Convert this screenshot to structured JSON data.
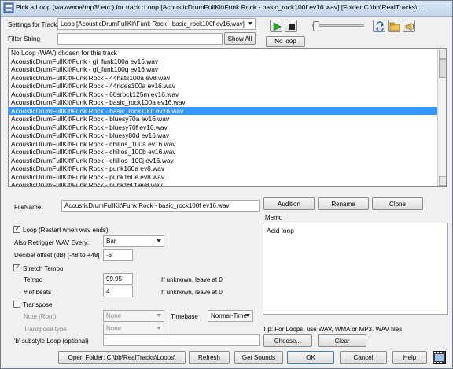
{
  "window": {
    "title": "Pick a Loop (wav/wma/mp3/ etc.) for track :Loop   [AcousticDrumFullKit\\Funk Rock - basic_rock100f ev16.wav]   [Folder:C:\\bb\\RealTracks\\..."
  },
  "settings": {
    "label": "Settings for Track",
    "track_value": "Loop   [AcousticDrumFullKit\\Funk Rock - basic_rock100f ev16.wav]",
    "filter_label": "Filter String",
    "filter_value": "",
    "show_all_label": "Show All",
    "no_loop_label": "No loop"
  },
  "transport": {
    "play_icon": "play-icon",
    "stop_icon": "stop-icon",
    "volume_level": 0.05
  },
  "file_list": {
    "items": [
      "No Loop (WAV) chosen for this track",
      "AcousticDrumFullKit\\Funk - gl_funk100a ev16.wav",
      "AcousticDrumFullKit\\Funk - gl_funk100q ev16.wav",
      "AcousticDrumFullKit\\Funk Rock - 44hats100a ev8.wav",
      "AcousticDrumFullKit\\Funk Rock - 44rides100a ev16.wav",
      "AcousticDrumFullKit\\Funk Rock - 60srock125m ev16.wav",
      "AcousticDrumFullKit\\Funk Rock - basic_rock100a ev16.wav",
      "AcousticDrumFullKit\\Funk Rock - basic_rock100f ev16.wav",
      "AcousticDrumFullKit\\Funk Rock - bluesy70a ev16.wav",
      "AcousticDrumFullKit\\Funk Rock - bluesy70f ev16.wav",
      "AcousticDrumFullKit\\Funk Rock - bluesy80d ev16.wav",
      "AcousticDrumFullKit\\Funk Rock - chillos_100a ev16.wav",
      "AcousticDrumFullKit\\Funk Rock - chillos_100b ev16.wav",
      "AcousticDrumFullKit\\Funk Rock - chillos_100j ev16.wav",
      "AcousticDrumFullKit\\Funk Rock - punk160a ev8.wav",
      "AcousticDrumFullKit\\Funk Rock - punk160e ev8.wav",
      "AcousticDrumFullKit\\Funk Rock - punk160f ev8.wav"
    ],
    "selected_index": 7
  },
  "details": {
    "filename_label": "FileName:",
    "filename_value": "AcousticDrumFullKit\\Funk Rock - basic_rock100f ev16.wav",
    "audition_label": "Audition",
    "rename_label": "Rename",
    "clone_label": "Clone",
    "memo_label": "Memo :",
    "memo_text": "Acid loop",
    "loop_label": "Loop (Restart when wav ends)",
    "loop_checked": true,
    "retrigger_label": "Also Retrigger WAV Every:",
    "retrigger_value": "Bar",
    "decibel_label": "Decibel offset (dB) [-48 to +48]",
    "decibel_value": "-6",
    "stretch_label": "Stretch Tempo",
    "stretch_checked": true,
    "tempo_label": "Tempo",
    "tempo_value": "99.95",
    "tempo_hint": "If unknown, leave at 0",
    "beats_label": "# of beats",
    "beats_value": "4",
    "beats_hint": "If unknown, leave at 0",
    "transpose_label": "Transpose",
    "transpose_checked": false,
    "note_label": "Note (Root)",
    "note_value": "None",
    "timebase_label": "Timebase",
    "timebase_value": "Normal-Time",
    "transpose_type_label": "Transpose type",
    "transpose_type_value": "None",
    "tip_text": "Tip: For Loops, use WAV, WMA or MP3. WAV files",
    "substyle_label": "'b' substyle Loop (optional)",
    "substyle_value": "",
    "choose_label": "Choose...",
    "clear_label": "Clear"
  },
  "footer": {
    "open_folder_label": "Open Folder: C:\\bb\\RealTracks\\Loops\\",
    "refresh_label": "Refresh",
    "get_sounds_label": "Get Sounds",
    "ok_label": "OK",
    "cancel_label": "Cancel",
    "help_label": "Help"
  }
}
